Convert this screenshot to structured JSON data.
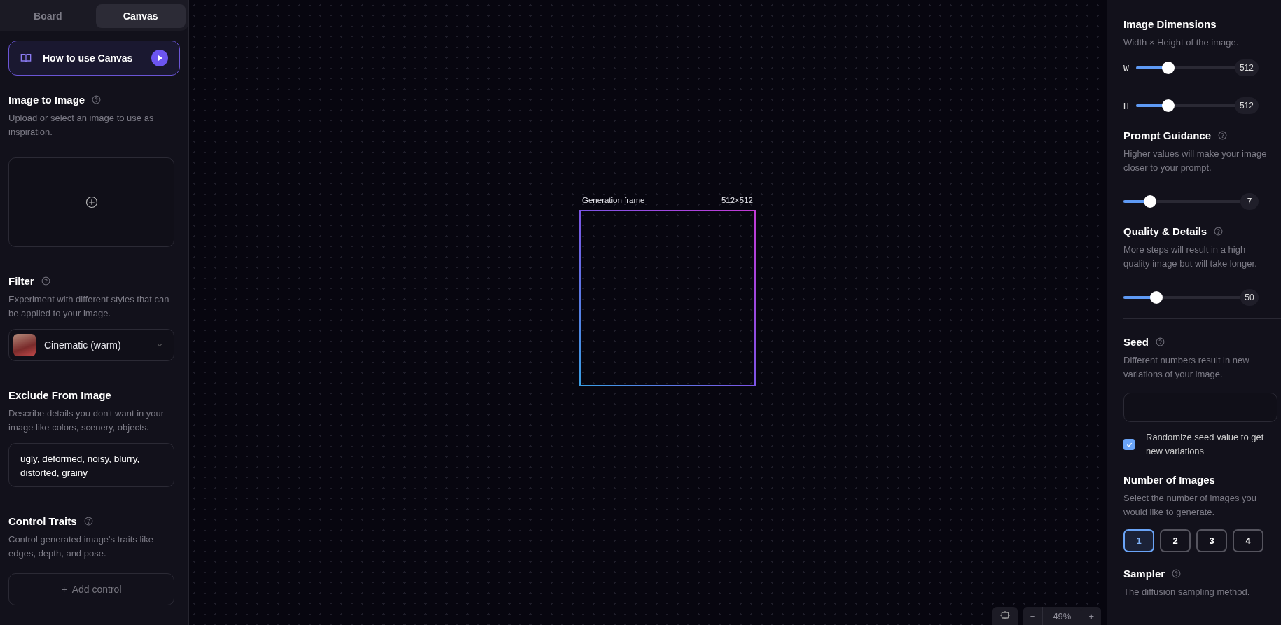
{
  "mode_tabs": [
    {
      "label": "Board",
      "selected": false
    },
    {
      "label": "Canvas",
      "selected": true
    }
  ],
  "tutorial_button": {
    "label": "How to use Canvas"
  },
  "left_sections": [
    {
      "kind": "upload",
      "title": "Image to Image",
      "help": true,
      "description": "Upload or select an image to use as inspiration."
    },
    {
      "kind": "select",
      "title": "Filter",
      "help": true,
      "description": "Experiment with different styles that can be applied to your image.",
      "value": "Cinematic (warm)"
    },
    {
      "kind": "textarea",
      "title": "Exclude From Image",
      "help": false,
      "description": "Describe details you don't want in your image like colors, scenery, objects.",
      "value": "ugly, deformed, noisy, blurry, distorted, grainy"
    },
    {
      "kind": "add",
      "title": "Control Traits",
      "help": true,
      "description": "Control generated image's traits like edges, depth, and pose.",
      "button": "+  Add control"
    }
  ],
  "canvas": {
    "frame_label": "Generation frame",
    "frame_size": "512×512",
    "zoom": "49%",
    "zoom_out": "−",
    "zoom_in": "+"
  },
  "right_sections": [
    {
      "kind": "dimensions",
      "title": "Image Dimensions",
      "help": false,
      "description": "Width × Height of the image.",
      "sliders": [
        {
          "label": "W",
          "level": 0.33,
          "value": "512"
        },
        {
          "label": "H",
          "level": 0.33,
          "value": "512"
        }
      ]
    },
    {
      "kind": "slider",
      "title": "Prompt Guidance",
      "help": true,
      "description": "Higher values will make your image closer to your prompt.",
      "level": 0.23,
      "value": "7"
    },
    {
      "kind": "slider",
      "title": "Quality & Details",
      "help": true,
      "description": "More steps will result in a high quality image but will take longer.",
      "level": 0.28,
      "value": "50"
    },
    {
      "kind": "seed",
      "title": "Seed",
      "help": true,
      "description": "Different numbers result in new variations of your image.",
      "checkbox": {
        "label": "Randomize seed value to get new variations",
        "checked": true
      }
    },
    {
      "kind": "count",
      "title": "Number of Images",
      "help": false,
      "description": "Select the number of images you would like to generate.",
      "options": [
        {
          "label": "1",
          "selected": true
        },
        {
          "label": "2",
          "selected": false
        },
        {
          "label": "3",
          "selected": false
        },
        {
          "label": "4",
          "selected": false
        }
      ]
    },
    {
      "kind": "plain",
      "title": "Sampler",
      "help": true,
      "description": "The diffusion sampling method."
    }
  ]
}
